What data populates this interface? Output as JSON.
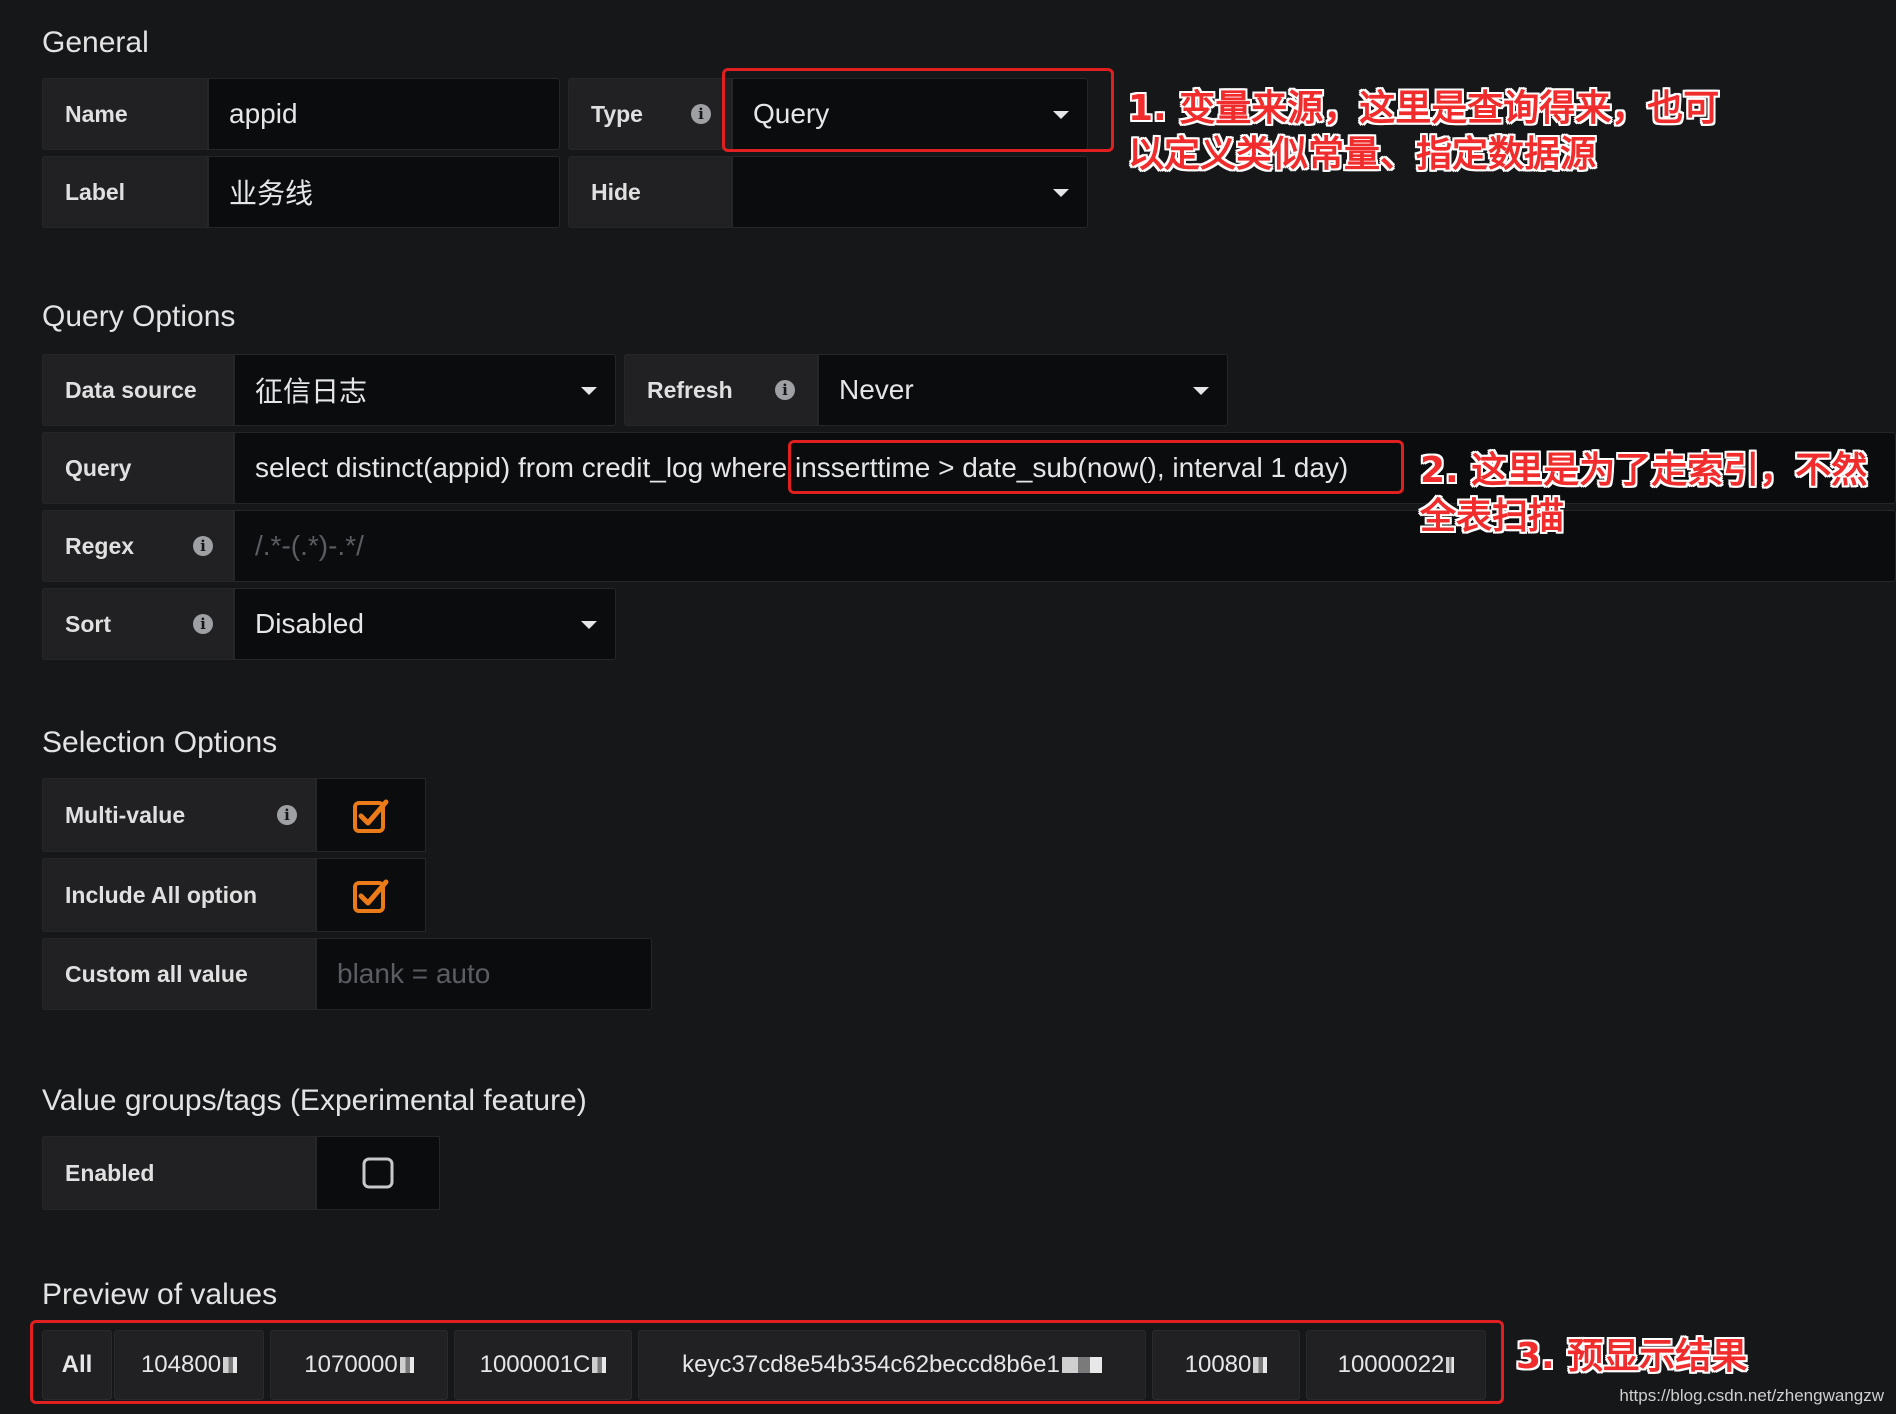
{
  "general": {
    "title": "General",
    "name_label": "Name",
    "name_value": "appid",
    "type_label": "Type",
    "type_value": "Query",
    "label_label": "Label",
    "label_value": "业务线",
    "hide_label": "Hide",
    "hide_value": ""
  },
  "query_options": {
    "title": "Query Options",
    "datasource_label": "Data source",
    "datasource_value": "征信日志",
    "refresh_label": "Refresh",
    "refresh_value": "Never",
    "query_label": "Query",
    "query_value": "select distinct(appid) from credit_log where insserttime > date_sub(now(), interval 1 day)",
    "regex_label": "Regex",
    "regex_placeholder": "/.*-(.*)-.*/",
    "sort_label": "Sort",
    "sort_value": "Disabled"
  },
  "selection_options": {
    "title": "Selection Options",
    "multi_label": "Multi-value",
    "multi_checked": true,
    "include_all_label": "Include All option",
    "include_all_checked": true,
    "custom_all_label": "Custom all value",
    "custom_all_placeholder": "blank = auto"
  },
  "value_groups": {
    "title": "Value groups/tags (Experimental feature)",
    "enabled_label": "Enabled",
    "enabled_checked": false
  },
  "preview": {
    "title": "Preview of values",
    "values": [
      "All",
      "104800",
      "1070000",
      "1000001C",
      "keyc37cd8e54b354c62beccd8b6e1",
      "10080",
      "10000022"
    ]
  },
  "annotations": {
    "a1_line1": "1. 变量来源，这里是查询得来，也可",
    "a1_line2": "以定义类似常量、指定数据源",
    "a2_line1": "2. 这里是为了走索引，不然",
    "a2_line2": "全表扫描",
    "a3": "3. 预显示结果"
  },
  "watermark": "https://blog.csdn.net/zhengwangzw",
  "colors": {
    "checkbox": "#eb7b18",
    "annotation": "#f02c2c",
    "background": "#161719"
  }
}
